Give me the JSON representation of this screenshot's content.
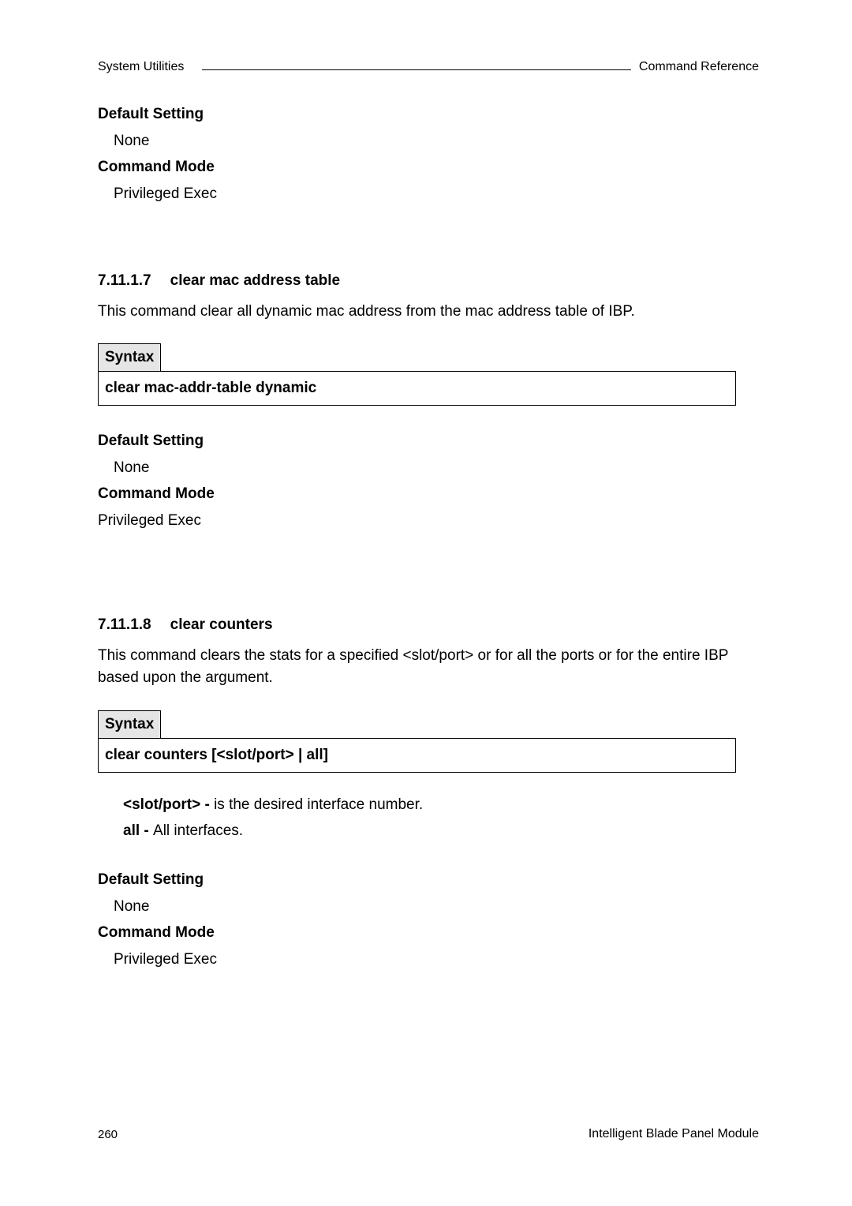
{
  "header": {
    "left": "System Utilities",
    "right": "Command Reference"
  },
  "section1": {
    "default_label": "Default Setting",
    "default_value": "None",
    "mode_label": "Command Mode",
    "mode_value": "Privileged Exec"
  },
  "section2": {
    "number": "7.11.1.7",
    "title": "clear mac address table",
    "desc": "This command clear all dynamic mac address from the mac address table of IBP.",
    "syntax_label": "Syntax",
    "syntax_body": "clear mac-addr-table dynamic",
    "default_label": "Default Setting",
    "default_value": "None",
    "mode_label": "Command Mode",
    "mode_value": "Privileged Exec"
  },
  "section3": {
    "number": "7.11.1.8",
    "title": "clear counters",
    "desc": "This command clears the stats for a specified <slot/port> or for all the ports or for the entire IBP based upon the argument.",
    "syntax_label": "Syntax",
    "syntax_body": "clear counters [<slot/port> | all]",
    "param1_label": "<slot/port> - ",
    "param1_value": "is the desired interface number.",
    "param2_label": "all - ",
    "param2_value": "All interfaces.",
    "default_label": "Default Setting",
    "default_value": "None",
    "mode_label": "Command Mode",
    "mode_value": "Privileged Exec"
  },
  "footer": {
    "page_number": "260",
    "product": "Intelligent Blade Panel Module"
  }
}
